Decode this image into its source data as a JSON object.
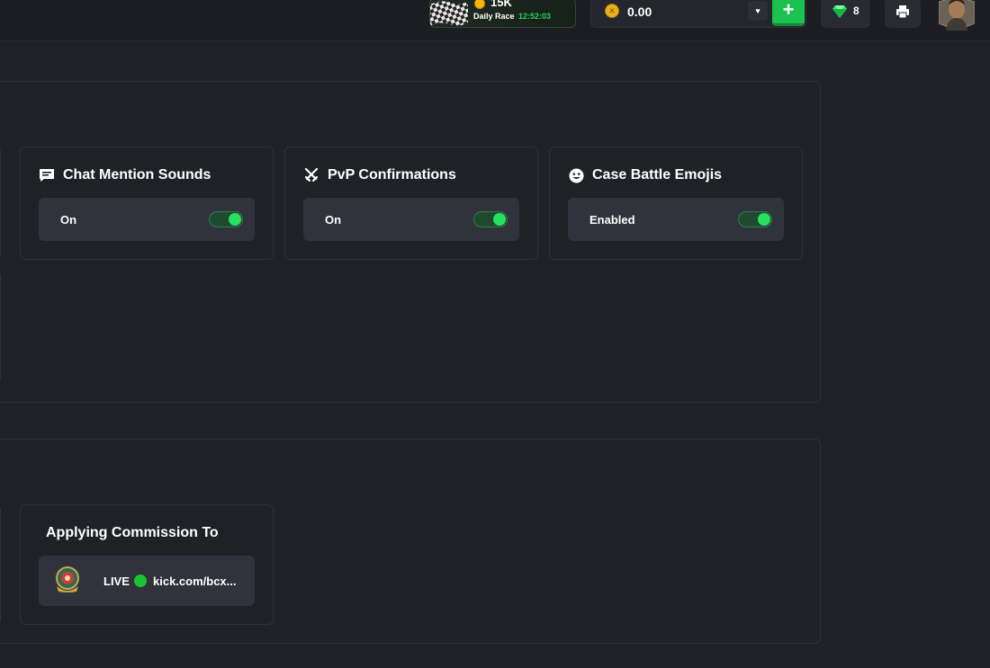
{
  "header": {
    "race": {
      "amount": "15K",
      "label": "Daily Race",
      "timer": "12:52:03"
    },
    "balance": {
      "value": "0.00",
      "coin_color": "#e8b01a",
      "dropdown_icon": "chevron-down-icon"
    },
    "deposit_icon": "plus-icon",
    "deposit_color": "#1bc24f",
    "gems": {
      "count": "8",
      "icon": "gem-icon",
      "color": "#2be36a"
    },
    "printer_icon": "printer-icon",
    "avatar_icon": "avatar"
  },
  "preferences": {
    "cards": [
      {
        "title": "Chat Mention Sounds",
        "icon": "chat-icon",
        "value": "On",
        "enabled": true
      },
      {
        "title": "PvP Confirmations",
        "icon": "crossed-swords-icon",
        "value": "On",
        "enabled": true
      },
      {
        "title": "Case Battle Emojis",
        "icon": "smiley-icon",
        "value": "Enabled",
        "enabled": true
      }
    ]
  },
  "affiliate": {
    "title": "Applying Commission To",
    "status": "LIVE",
    "url": "kick.com/bcx..."
  },
  "colors": {
    "background": "#1f2127",
    "card_row": "#30333b",
    "toggle_on": "#27e05f",
    "live_green": "#17c532",
    "timer_green": "#26d35c"
  }
}
